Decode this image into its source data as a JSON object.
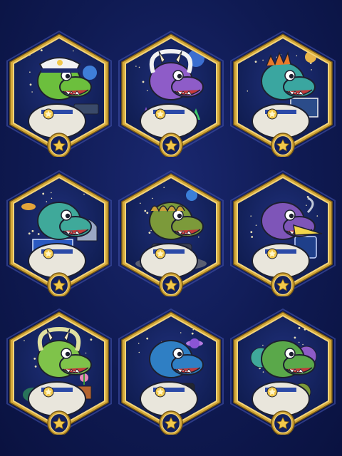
{
  "colors": {
    "background": "#0f1a52",
    "frame_outer": "#d4a93a",
    "frame_inner": "#f3d479",
    "medal": "#f2c84a",
    "space": "#0d1a4a"
  },
  "badges": [
    {
      "id": "trex-captain",
      "icon": "t-rex-captain-icon",
      "scene": "cockpit"
    },
    {
      "id": "triceratops-geologist",
      "icon": "triceratops-geologist-icon",
      "scene": "crystals"
    },
    {
      "id": "stegosaurus-navigator",
      "icon": "stegosaurus-navigator-icon",
      "scene": "star-map"
    },
    {
      "id": "brachiosaurus-engineer",
      "icon": "brachiosaurus-engineer-icon",
      "scene": "blueprint"
    },
    {
      "id": "ankylosaurus-driver",
      "icon": "ankylosaurus-driver-icon",
      "scene": "moon-rover"
    },
    {
      "id": "pteranodon-communications",
      "icon": "pteranodon-communications-icon",
      "scene": "satellite"
    },
    {
      "id": "triceratops-botanist",
      "icon": "triceratops-botanist-icon",
      "scene": "plants"
    },
    {
      "id": "raptor-photographer",
      "icon": "raptor-photographer-icon",
      "scene": "camera"
    },
    {
      "id": "crew-group",
      "icon": "crew-group-icon",
      "scene": "team"
    }
  ]
}
